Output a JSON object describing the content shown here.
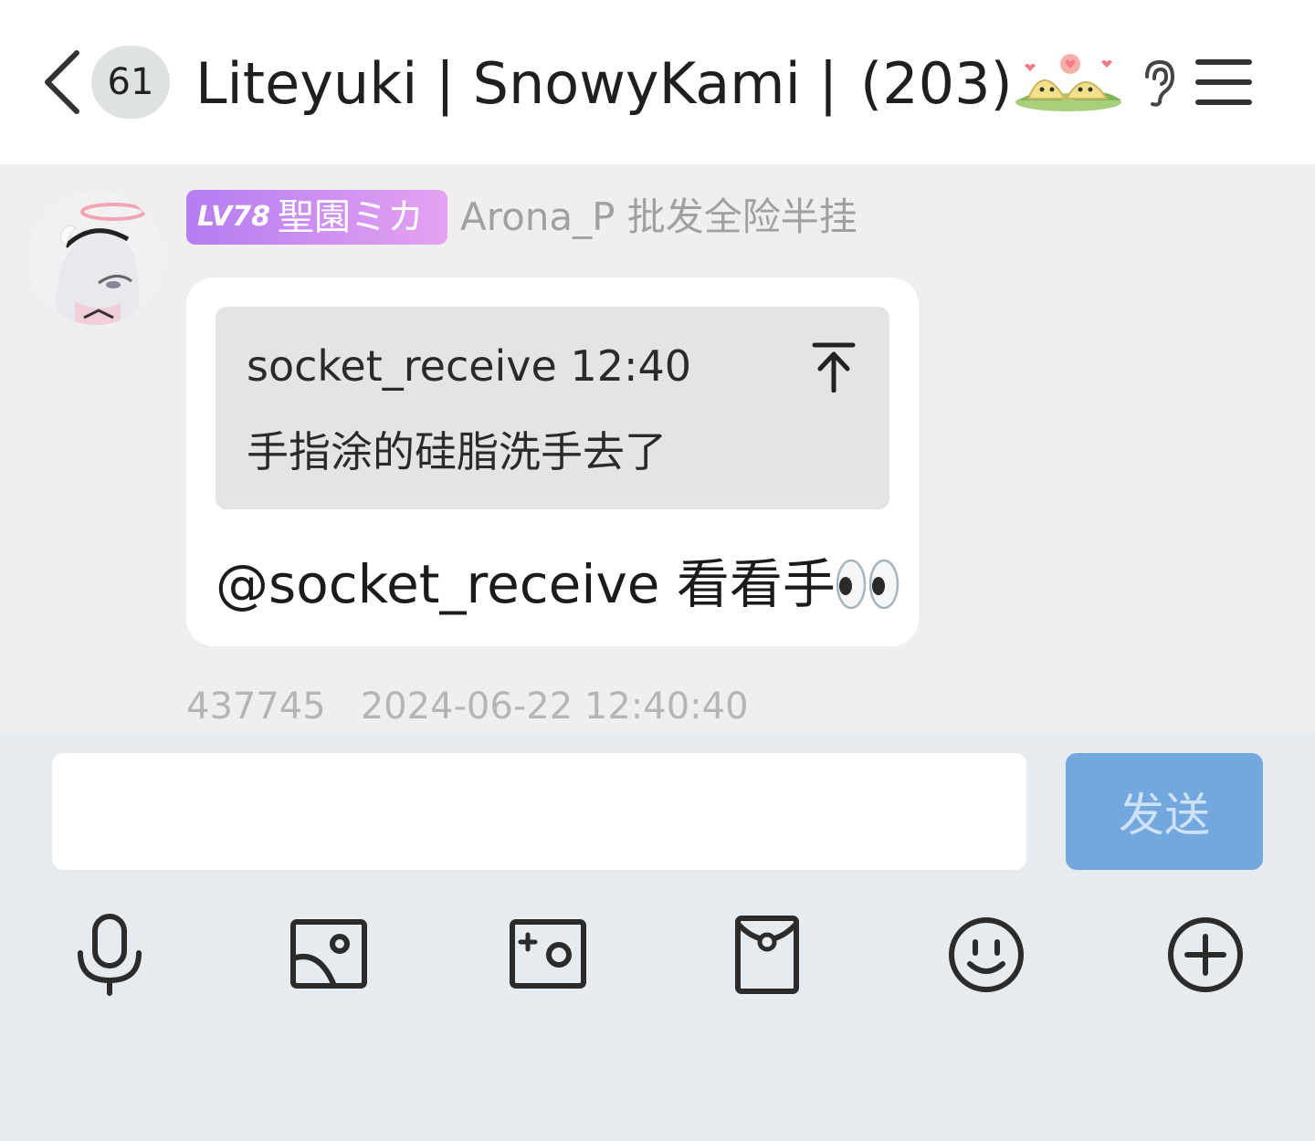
{
  "header": {
    "unread_count": "61",
    "title": "Liteyuki | SnowyKami |…",
    "member_count": "(203)"
  },
  "message": {
    "badge_level": "LV78",
    "badge_title": "聖園ミカ",
    "sender_name": "Arona_P 批发全险半挂",
    "quote": {
      "author": "socket_receive 12:40",
      "text": "手指涂的硅脂洗手去了"
    },
    "text": "@socket_receive 看看手",
    "emoji_icon": "eyes-emoji",
    "message_id": "437745",
    "timestamp": "2024-06-22 12:40:40"
  },
  "input": {
    "placeholder": "",
    "send_label": "发送"
  },
  "toolbar": {
    "icons": [
      "microphone-icon",
      "image-icon",
      "camera-icon",
      "red-packet-icon",
      "emoji-icon",
      "plus-icon"
    ]
  },
  "colors": {
    "send_button": "#73a8df",
    "badge_gradient_start": "#b57cf2",
    "badge_gradient_end": "#e4a2f0",
    "chat_background": "#efefef",
    "input_area_background": "#e6ebf0"
  }
}
